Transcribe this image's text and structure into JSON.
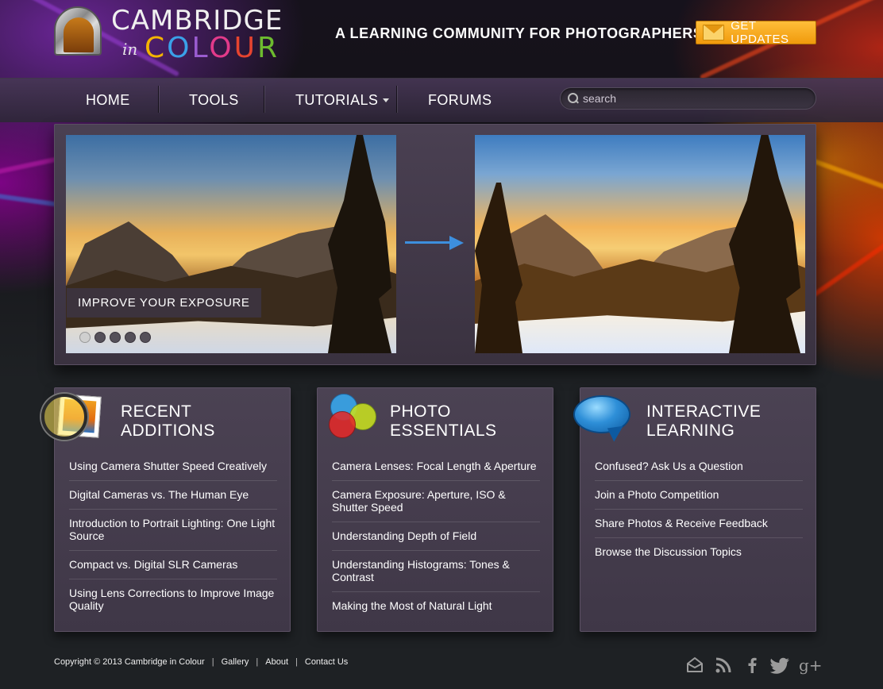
{
  "header": {
    "logo": {
      "line1": "CAMBRIDGE",
      "in": "in",
      "colour_letters": [
        "C",
        "O",
        "L",
        "O",
        "U",
        "R"
      ]
    },
    "tagline": "A LEARNING COMMUNITY FOR PHOTOGRAPHERS",
    "get_updates": "GET UPDATES"
  },
  "nav": {
    "items": [
      {
        "label": "HOME"
      },
      {
        "label": "TOOLS"
      },
      {
        "label": "TUTORIALS"
      },
      {
        "label": "FORUMS"
      }
    ],
    "search_placeholder": "search"
  },
  "slider": {
    "caption": "IMPROVE YOUR EXPOSURE",
    "dots_total": 5,
    "active_dot": 1
  },
  "cards": [
    {
      "title": "RECENT\nADDITIONS",
      "icon": "magnifier-photo-icon",
      "items": [
        "Using Camera Shutter Speed Creatively",
        "Digital Cameras vs. The Human Eye",
        "Introduction to Portrait Lighting: One Light Source",
        "Compact vs. Digital SLR Cameras",
        "Using Lens Corrections to Improve Image Quality"
      ]
    },
    {
      "title": "PHOTO\nESSENTIALS",
      "icon": "rgb-circles-icon",
      "items": [
        "Camera Lenses: Focal Length & Aperture",
        "Camera Exposure: Aperture, ISO & Shutter Speed",
        "Understanding Depth of Field",
        "Understanding Histograms: Tones & Contrast",
        "Making the Most of Natural Light"
      ]
    },
    {
      "title": "INTERACTIVE\nLEARNING",
      "icon": "speech-bubble-icon",
      "items": [
        "Confused? Ask Us a Question",
        "Join a Photo Competition",
        "Share Photos & Receive Feedback",
        "Browse the Discussion Topics"
      ]
    }
  ],
  "footer": {
    "copyright": "Copyright © 2013 Cambridge in Colour",
    "links": [
      "Gallery",
      "About",
      "Contact Us"
    ],
    "social_icons": [
      "envelope-icon",
      "rss-icon",
      "facebook-icon",
      "twitter-icon",
      "google-plus-icon"
    ]
  },
  "colors": {
    "accent_orange": "#f5a623",
    "arrow_blue": "#3d8fde",
    "panel": "#453c4d"
  }
}
